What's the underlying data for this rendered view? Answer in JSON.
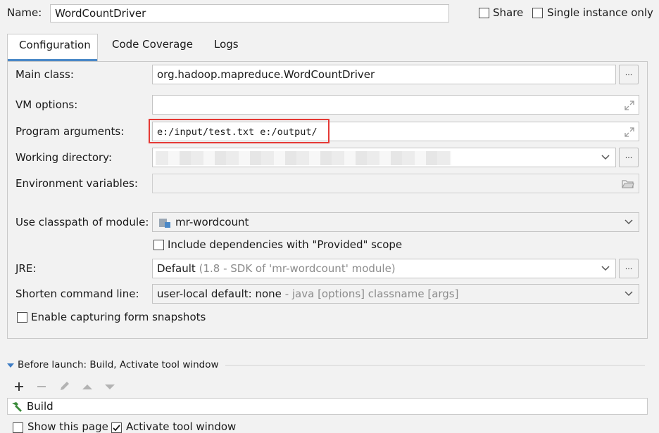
{
  "header": {
    "name_label": "Name:",
    "name_value": "WordCountDriver",
    "share_label": "Share",
    "single_instance_label": "Single instance only"
  },
  "tabs": [
    {
      "label": "Configuration",
      "active": true
    },
    {
      "label": "Code Coverage",
      "active": false
    },
    {
      "label": "Logs",
      "active": false
    }
  ],
  "config": {
    "main_class_label": "Main class:",
    "main_class_value": "org.hadoop.mapreduce.WordCountDriver",
    "vm_options_label": "VM options:",
    "vm_options_value": "",
    "program_args_label": "Program arguments:",
    "program_args_value": "e:/input/test.txt e:/output/",
    "working_dir_label": "Working directory:",
    "working_dir_value": "",
    "env_vars_label": "Environment variables:",
    "env_vars_value": "",
    "classpath_label": "Use classpath of module:",
    "classpath_value": "mr-wordcount",
    "include_deps_label": "Include dependencies with \"Provided\" scope",
    "jre_label": "JRE:",
    "jre_value": "Default",
    "jre_detail": "(1.8 - SDK of 'mr-wordcount' module)",
    "shorten_label": "Shorten command line:",
    "shorten_value": "user-local default: none",
    "shorten_detail": "- java [options] classname [args]",
    "snapshots_label": "Enable capturing form snapshots",
    "browse_label": "..."
  },
  "before_launch": {
    "title": "Before launch: Build, Activate tool window",
    "items": [
      "Build"
    ],
    "show_page_label": "Show this page",
    "activate_label": "Activate tool window"
  },
  "colors": {
    "highlight_box": "#e53935",
    "tab_underline": "#4a88c7",
    "accent_arrow": "#3d7cc4",
    "build_icon": "#3a8a3a"
  }
}
